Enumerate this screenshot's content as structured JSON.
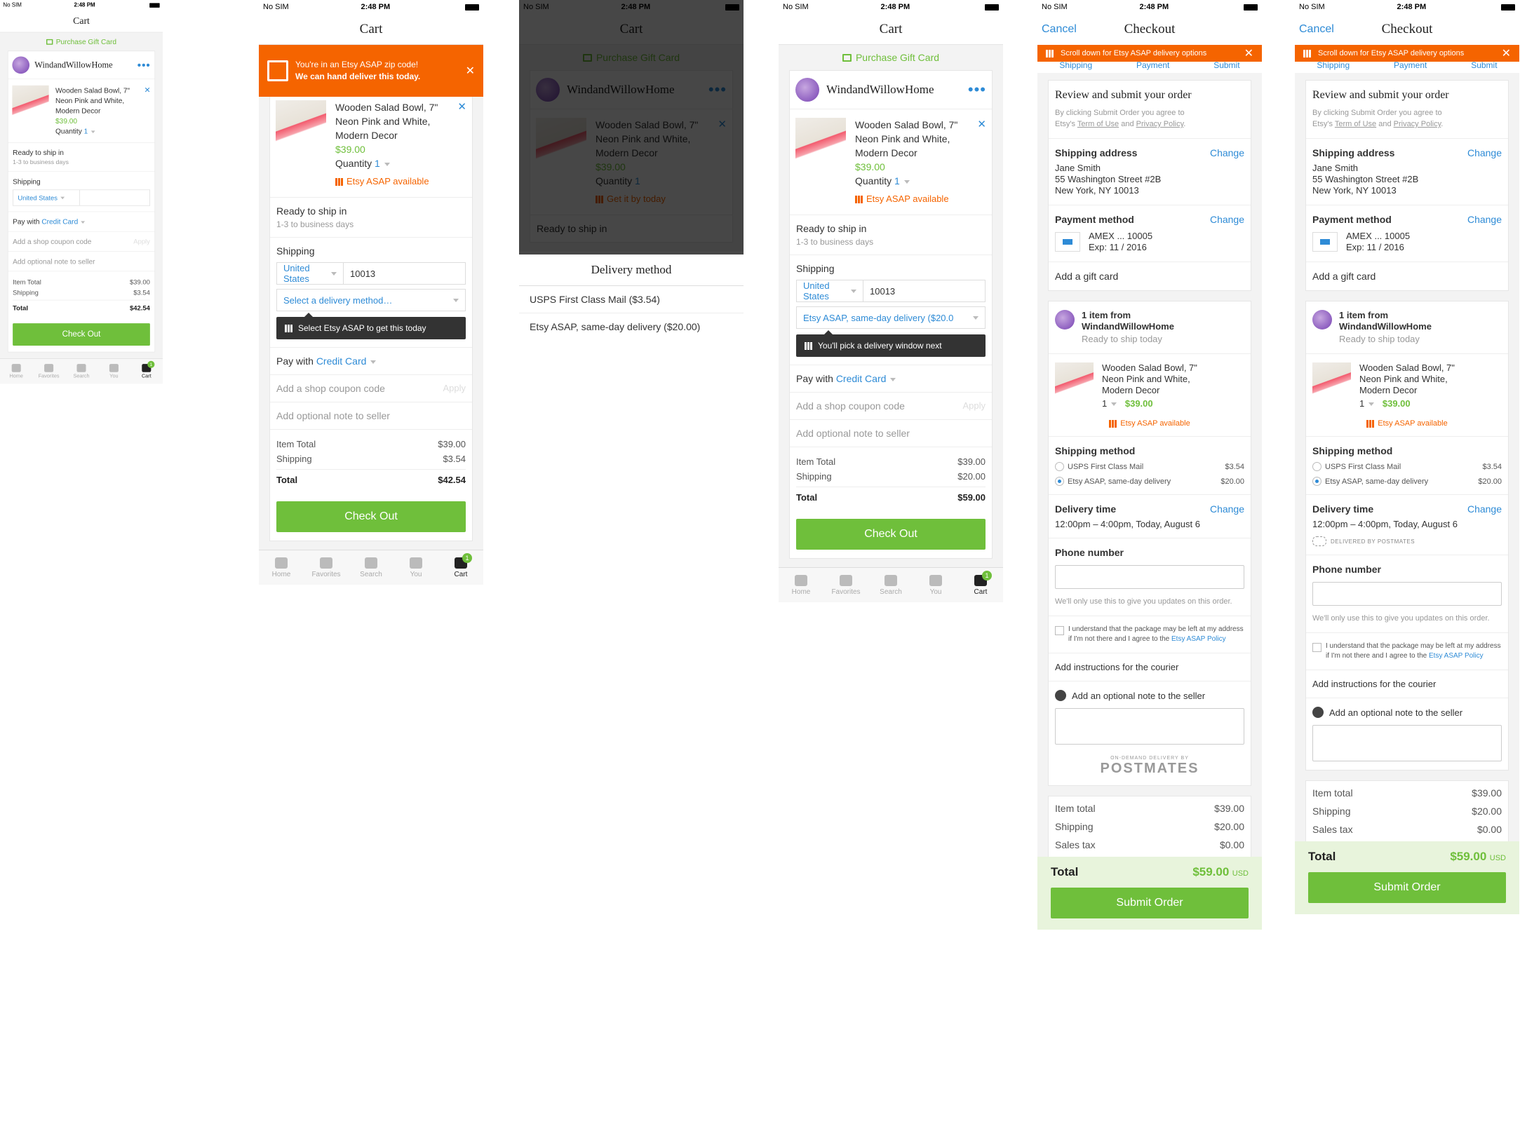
{
  "status": {
    "carrier": "No SIM",
    "time": "2:48 PM"
  },
  "cart": {
    "title": "Cart",
    "gift_card": "Purchase Gift Card",
    "shop_name": "WindandWillowHome",
    "item_title_1": "Wooden Salad Bowl, 7\"",
    "item_title_2": "Neon Pink and White,",
    "item_title_3": "Modern Decor",
    "price": "$39.00",
    "quantity_label": "Quantity",
    "quantity_value": "1",
    "asap_available": "Etsy ASAP available",
    "get_it_by": "Get it by today",
    "ready_label": "Ready to ship in",
    "ready_sub": "1-3 to business days",
    "shipping_label": "Shipping",
    "country": "United States",
    "zip": "10013",
    "delivery_placeholder": "Select a delivery method…",
    "delivery_selected": "Etsy ASAP, same-day delivery ($20.0",
    "tooltip_select": "Select Etsy ASAP to get this today",
    "tooltip_window": "You'll pick a delivery window next",
    "pay_with": "Pay with",
    "pay_method": "Credit Card",
    "coupon": "Add a shop coupon code",
    "apply": "Apply",
    "note": "Add optional note to seller",
    "item_total_label": "Item Total",
    "shipping_total_label": "Shipping",
    "total_label": "Total",
    "item_total": "$39.00",
    "shipping_cost_a": "$3.54",
    "total_a": "$42.54",
    "shipping_cost_b": "$20.00",
    "total_b": "$59.00",
    "checkout": "Check Out",
    "banner_line1": "You're in an Etsy ASAP zip code!",
    "banner_line2": "We can hand deliver this today."
  },
  "tabs": [
    {
      "label": "Home"
    },
    {
      "label": "Favorites"
    },
    {
      "label": "Search"
    },
    {
      "label": "You"
    },
    {
      "label": "Cart",
      "badge": "1"
    }
  ],
  "delivery_sheet": {
    "title": "Delivery method",
    "options": [
      "USPS First Class Mail ($3.54)",
      "Etsy ASAP, same-day delivery ($20.00)"
    ]
  },
  "checkout": {
    "title": "Checkout",
    "cancel": "Cancel",
    "banner": "Scroll down for Etsy ASAP delivery options",
    "steps": [
      "Shipping",
      "Payment",
      "Submit"
    ],
    "review_title": "Review and submit your order",
    "review_sub_1": "By clicking Submit Order you agree to",
    "review_sub_2a": "Etsy's ",
    "review_terms": "Term of Use",
    "review_and": " and ",
    "review_privacy": "Privacy Policy",
    "review_end": ".",
    "ship_addr_label": "Shipping address",
    "change": "Change",
    "addr_name": "Jane Smith",
    "addr_street": "55 Washington Street #2B",
    "addr_city": "New York, NY 10013",
    "payment_label": "Payment method",
    "card": "AMEX ... 10005",
    "exp": "Exp: 11 / 2016",
    "gift_card": "Add a gift card",
    "items_from": "1 item from",
    "shop": "WindandWillowHome",
    "ready_today": "Ready to ship today",
    "qty": "1",
    "price": "$39.00",
    "ship_method_label": "Shipping method",
    "usps": "USPS First Class Mail",
    "usps_price": "$3.54",
    "asap": "Etsy ASAP, same-day delivery",
    "asap_price": "$20.00",
    "delivery_time_label": "Delivery time",
    "delivery_time": "12:00pm – 4:00pm, Today, August 6",
    "delivered_by": "DELIVERED BY POSTMATES",
    "phone_label": "Phone number",
    "phone_help": "We'll only use this to give you updates on this order.",
    "agree_1": "I understand that the package may be left at my address if I'm not there and I agree to the ",
    "agree_link": "Etsy ASAP Policy",
    "courier": "Add instructions for the courier",
    "seller_note": "Add an optional note to the seller",
    "postmates_small": "ON-DEMAND DELIVERY BY",
    "postmates": "POSTMATES",
    "item_total_label": "Item total",
    "item_total": "$39.00",
    "shipping_label": "Shipping",
    "shipping": "$20.00",
    "tax_label": "Sales tax",
    "tax": "$0.00",
    "total_label": "Total",
    "total": "$59.00",
    "currency": "USD",
    "submit": "Submit Order"
  },
  "colors": {
    "green": "#6fbf3b",
    "orange": "#f56400",
    "blue": "#2e8bd6"
  }
}
